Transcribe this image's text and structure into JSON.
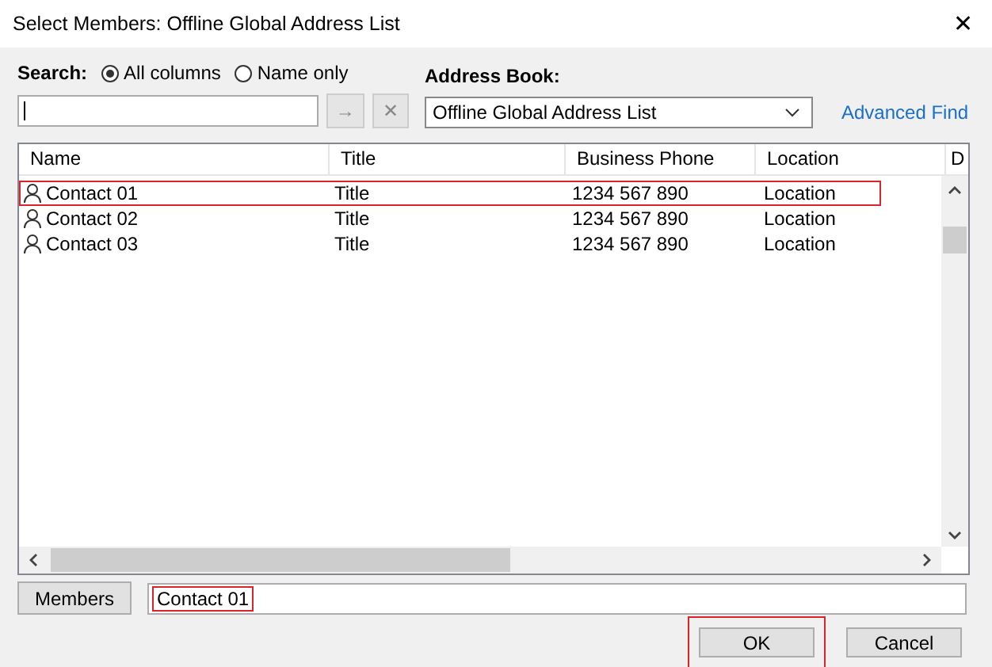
{
  "window": {
    "title": "Select Members: Offline Global Address List",
    "close": "✕"
  },
  "search": {
    "label": "Search:",
    "options": [
      {
        "label": "All columns",
        "selected": true
      },
      {
        "label": "Name only",
        "selected": false
      }
    ],
    "go": "→",
    "clear": "✕"
  },
  "address_book": {
    "label": "Address Book:",
    "value": "Offline Global Address List",
    "advanced_find": "Advanced Find"
  },
  "table": {
    "columns": [
      "Name",
      "Title",
      "Business Phone",
      "Location",
      "D"
    ],
    "rows": [
      {
        "cells": [
          "Contact 01",
          "Title",
          "1234 567 890",
          "Location"
        ],
        "highlighted": true
      },
      {
        "cells": [
          "Contact 02",
          "Title",
          "1234 567 890",
          "Location"
        ],
        "highlighted": false
      },
      {
        "cells": [
          "Contact 03",
          "Title",
          "1234 567 890",
          "Location"
        ],
        "highlighted": false
      }
    ]
  },
  "members": {
    "button": "Members",
    "value": "Contact 01",
    "highlighted": true
  },
  "buttons": [
    {
      "label": "OK",
      "highlighted": true
    },
    {
      "label": "Cancel",
      "highlighted": false
    }
  ]
}
